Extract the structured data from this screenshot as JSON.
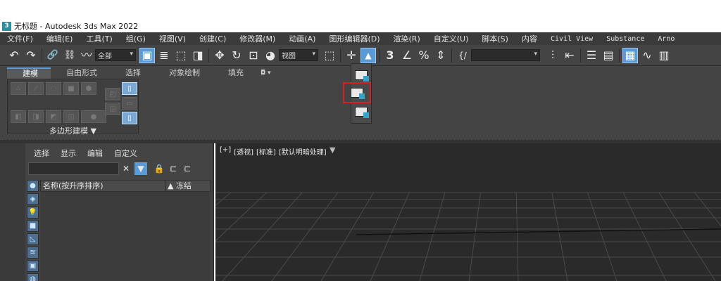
{
  "title": {
    "text": "无标题 - Autodesk 3ds Max 2022",
    "icon": "3"
  },
  "menu": [
    {
      "label": "文件(F)"
    },
    {
      "label": "编辑(E)"
    },
    {
      "label": "工具(T)"
    },
    {
      "label": "组(G)"
    },
    {
      "label": "视图(V)"
    },
    {
      "label": "创建(C)"
    },
    {
      "label": "修改器(M)"
    },
    {
      "label": "动画(A)"
    },
    {
      "label": "图形编辑器(D)"
    },
    {
      "label": "渲染(R)"
    },
    {
      "label": "自定义(U)"
    },
    {
      "label": "脚本(S)"
    },
    {
      "label": "内容"
    },
    {
      "label": "Civil View"
    },
    {
      "label": "Substance"
    },
    {
      "label": "Arno"
    }
  ],
  "toolbar": {
    "selection_filter": "全部",
    "reference_coord": "视图",
    "named_selection": "",
    "icons": {
      "undo": "↶",
      "redo": "↷",
      "link": "🔗",
      "unlink": "⛓",
      "bind": "〰",
      "select": "▣",
      "select_name": "≣",
      "rect": "⬚",
      "window": "◨",
      "move": "✥",
      "rotate": "↻",
      "scale": "⊡",
      "place": "◕",
      "pivot": "⬚",
      "snap_main": "✛",
      "snap3": "3",
      "angle": "∠",
      "percent": "%",
      "spinner": "⇕",
      "edit_named": "{/",
      "mirror": "⫶",
      "align": "⇤",
      "layers": "☰",
      "toggle": "▤",
      "ribbon": "▦",
      "curve": "∿"
    }
  },
  "ribbon": {
    "tabs": [
      "建模",
      "自由形式",
      "选择",
      "对象绘制",
      "填充"
    ],
    "selected_tab": "建模",
    "panel_label": "多边形建模 ▼"
  },
  "flyout": {
    "items": [
      "use-pivot-point-center",
      "use-selection-center",
      "use-transform-coordinate-center"
    ],
    "highlighted_index": 1
  },
  "explorer": {
    "menu": [
      "选择",
      "显示",
      "编辑",
      "自定义"
    ],
    "search_value": "",
    "columns": [
      "名称(按升序排序)",
      "▲ 冻结"
    ],
    "filter_icons": [
      "sphere-icon",
      "shapes-icon",
      "light-icon",
      "camera-icon",
      "helper-icon",
      "spacewarp-icon",
      "group-icon",
      "xref-icon"
    ]
  },
  "viewport": {
    "labels": [
      "[+]",
      "[透视]",
      "[标准]",
      "[默认明暗处理]"
    ],
    "filter_glyph": "▼"
  }
}
